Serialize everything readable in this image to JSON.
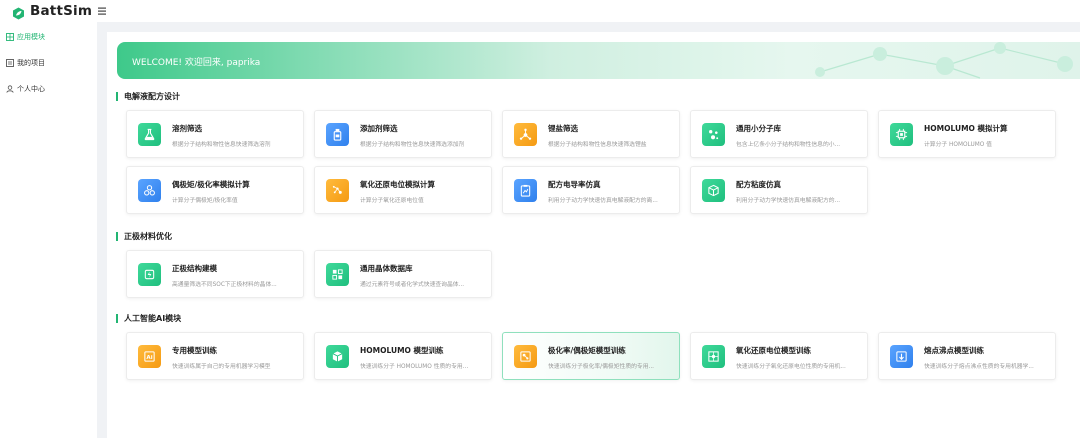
{
  "app": {
    "name": "BattSim"
  },
  "sidebar": {
    "items": [
      {
        "label": "应用模块",
        "active": true,
        "icon": "grid-icon"
      },
      {
        "label": "我的项目",
        "active": false,
        "icon": "list-icon"
      },
      {
        "label": "个人中心",
        "active": false,
        "icon": "user-icon"
      }
    ]
  },
  "banner": {
    "text": "WELCOME! 欢迎回来, paprika"
  },
  "sections": [
    {
      "title": "电解液配方设计",
      "cards": [
        {
          "title": "溶剂筛选",
          "desc": "根据分子结构和物性信息快速筛选溶剂",
          "color": "green",
          "icon": "flask-icon"
        },
        {
          "title": "添加剂筛选",
          "desc": "根据分子结构和物性信息快速筛选添加剂",
          "color": "blue",
          "icon": "bottle-icon"
        },
        {
          "title": "锂盐筛选",
          "desc": "根据分子结构和物性信息快速筛选锂盐",
          "color": "orange",
          "icon": "molecule-icon"
        },
        {
          "title": "通用小分子库",
          "desc": "包含上亿条小分子结构和物性信息的小...",
          "color": "green",
          "icon": "atoms-icon"
        },
        {
          "title": "HOMOLUMO 模拟计算",
          "desc": "计算分子 HOMOLUMO 值",
          "color": "green",
          "icon": "chip-icon"
        },
        {
          "title": "偶极矩/极化率模拟计算",
          "desc": "计算分子偶极矩/极化率值",
          "color": "blue",
          "icon": "orbit-icon"
        },
        {
          "title": "氧化还原电位模拟计算",
          "desc": "计算分子氧化还原电位值",
          "color": "orange",
          "icon": "redox-icon"
        },
        {
          "title": "配方电导率仿真",
          "desc": "利用分子动力学快速仿真电解液配方的离...",
          "color": "blue",
          "icon": "clipboard-icon"
        },
        {
          "title": "配方粘度仿真",
          "desc": "利用分子动力学快速仿真电解液配方的...",
          "color": "green",
          "icon": "cube-icon"
        }
      ]
    },
    {
      "title": "正极材料优化",
      "cards": [
        {
          "title": "正极结构建模",
          "desc": "高通量筛选不同SOC下正极材料的晶体...",
          "color": "green",
          "icon": "cathode-icon"
        },
        {
          "title": "通用晶体数据库",
          "desc": "通过元素符号或者化学式快速查询晶体...",
          "color": "green",
          "icon": "crystal-icon"
        }
      ]
    },
    {
      "title": "人工智能AI模块",
      "cards": [
        {
          "title": "专用模型训练",
          "desc": "快速训练属于自己的专用机器学习模型",
          "color": "orange",
          "icon": "ai-icon"
        },
        {
          "title": "HOMOLUMO 模型训练",
          "desc": "快速训练分子 HOMOLUMO 性质的专用...",
          "color": "green",
          "icon": "model-icon"
        },
        {
          "title": "极化率/偶极矩模型训练",
          "desc": "快速训练分子极化率/偶极矩性质的专用...",
          "color": "orange",
          "icon": "polar-icon",
          "highlight": true
        },
        {
          "title": "氧化还原电位模型训练",
          "desc": "快速训练分子氧化还原电位性质的专用机...",
          "color": "green",
          "icon": "target-icon"
        },
        {
          "title": "熔点沸点模型训练",
          "desc": "快速训练分子熔点沸点性质的专用机器学...",
          "color": "blue",
          "icon": "thermo-icon"
        }
      ]
    }
  ],
  "colors": {
    "accent": "#22b573",
    "green": "#1fbf7e",
    "blue": "#2f80ed",
    "orange": "#f59a12"
  }
}
